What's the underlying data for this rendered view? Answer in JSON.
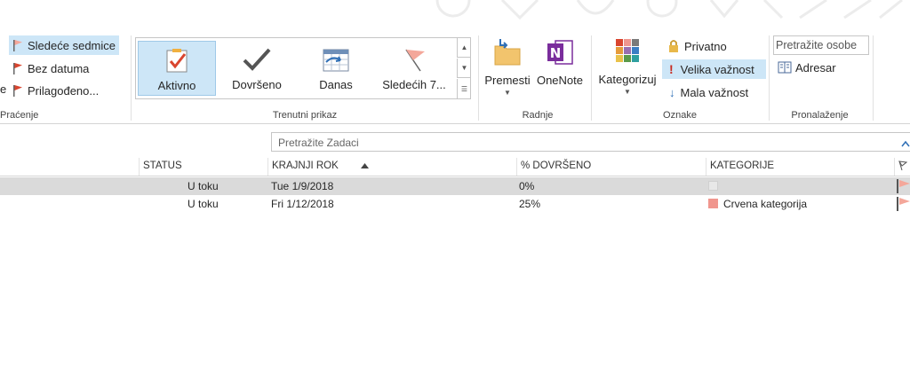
{
  "follow_up": {
    "items": [
      {
        "label": "Sledeće sedmice",
        "selected": true
      },
      {
        "label": "Bez datuma",
        "selected": false
      },
      {
        "label": "Prilagođeno...",
        "selected": false
      }
    ],
    "group_label": "Praćenje"
  },
  "current_view": {
    "items": [
      {
        "label": "Aktivno",
        "selected": true
      },
      {
        "label": "Dovršeno",
        "selected": false
      },
      {
        "label": "Danas",
        "selected": false
      },
      {
        "label": "Sledećih 7...",
        "selected": false
      }
    ],
    "group_label": "Trenutni prikaz"
  },
  "actions": {
    "move_label": "Premesti",
    "onenote_label": "OneNote",
    "group_label": "Radnje"
  },
  "tags": {
    "categorize_label": "Kategorizuj",
    "private_label": "Privatno",
    "high_importance_label": "Velika važnost",
    "low_importance_label": "Mala važnost",
    "group_label": "Oznake"
  },
  "find": {
    "search_people_placeholder": "Pretražite osobe",
    "address_book_label": "Adresar",
    "group_label": "Pronalaženje"
  },
  "search": {
    "placeholder": "Pretražite Zadaci"
  },
  "table": {
    "headers": {
      "status": "STATUS",
      "due_date": "KRAJNJI ROK",
      "percent": "% DOVRŠENO",
      "category": "KATEGORIJE"
    },
    "rows": [
      {
        "status": "U toku",
        "due_date": "Tue 1/9/2018",
        "percent": "0%",
        "category": "",
        "category_color": "#e8e8e8",
        "selected": true
      },
      {
        "status": "U toku",
        "due_date": "Fri 1/12/2018",
        "percent": "25%",
        "category": "Crvena kategorija",
        "category_color": "#f0968e",
        "selected": false
      }
    ]
  },
  "colors": {
    "selection": "#cde6f7",
    "flag_red": "#d9452f",
    "flag_pink": "#f4a79a",
    "onenote": "#7a2d9c",
    "importance_high": "#c8281e",
    "importance_low": "#2f6fb6"
  }
}
